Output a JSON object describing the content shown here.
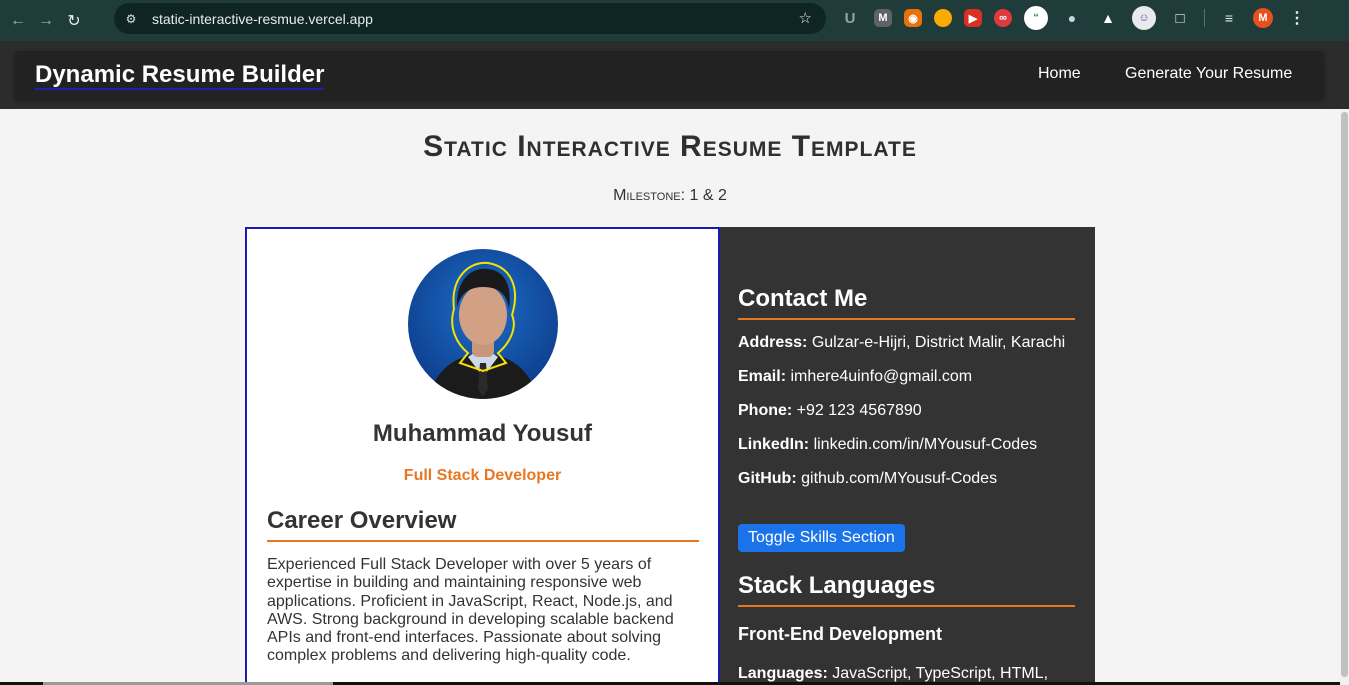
{
  "browser": {
    "url": "static-interactive-resmue.vercel.app",
    "icons": {
      "back": "arrow-left-icon",
      "forward": "arrow-right-icon",
      "reload": "reload-icon",
      "site_info": "site-settings-icon",
      "bookmark": "star-icon"
    },
    "profile_initial": "M",
    "extension_colors": [
      "#9aa0a6",
      "#7b7b7b",
      "#e8710a",
      "#f9ab00",
      "#d93025",
      "#e03a3e",
      "#1e8e3e",
      "#4a6fa5",
      "#1a237e",
      "#ffffff"
    ]
  },
  "header": {
    "brand": "Dynamic Resume Builder",
    "nav": [
      {
        "label": "Home"
      },
      {
        "label": "Generate Your Resume"
      }
    ]
  },
  "page": {
    "title": "Static Interactive Resume Template",
    "subtitle": "Milestone: 1 & 2"
  },
  "profile": {
    "name": "Muhammad Yousuf",
    "role": "Full Stack Developer"
  },
  "career": {
    "heading": "Career Overview",
    "text": "Experienced Full Stack Developer with over 5 years of expertise in building and maintaining responsive web applications. Proficient in JavaScript, React, Node.js, and AWS. Strong background in developing scalable backend APIs and front-end interfaces. Passionate about solving complex problems and delivering high-quality code."
  },
  "contact": {
    "heading": "Contact Me",
    "items": [
      {
        "label": "Address:",
        "value": "Gulzar-e-Hijri, District Malir, Karachi"
      },
      {
        "label": "Email:",
        "value": "imhere4uinfo@gmail.com"
      },
      {
        "label": "Phone:",
        "value": "+92 123 4567890"
      },
      {
        "label": "LinkedIn:",
        "value": "linkedin.com/in/MYousuf-Codes"
      },
      {
        "label": "GitHub:",
        "value": "github.com/MYousuf-Codes"
      }
    ]
  },
  "skills": {
    "toggle_label": "Toggle Skills Section",
    "heading": "Stack Languages",
    "frontend_heading": "Front-End Development",
    "languages_label": "Languages:",
    "languages_value": "JavaScript, TypeScript, HTML,"
  },
  "colors": {
    "accent": "#e87722",
    "button": "#1a73e8",
    "dark_panel": "#333333",
    "left_border": "#1a1ab0"
  }
}
